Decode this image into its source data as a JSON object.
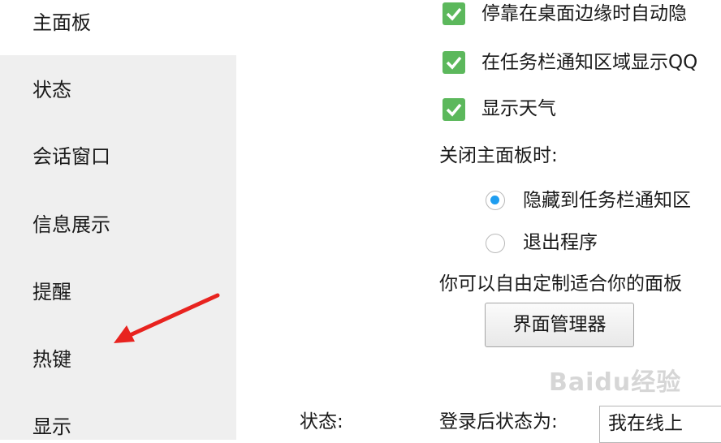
{
  "sidebar": {
    "items": [
      {
        "label": "主面板"
      },
      {
        "label": "状态"
      },
      {
        "label": "会话窗口"
      },
      {
        "label": "信息展示"
      },
      {
        "label": "提醒"
      },
      {
        "label": "热键"
      },
      {
        "label": "显示"
      }
    ]
  },
  "main": {
    "checkboxes": [
      {
        "label": "停靠在桌面边缘时自动隐",
        "checked": true
      },
      {
        "label": "在任务栏通知区域显示QQ",
        "checked": true
      },
      {
        "label": "显示天气",
        "checked": true
      }
    ],
    "close_label": "关闭主面板时:",
    "radios": [
      {
        "label": "隐藏到任务栏通知区",
        "checked": true
      },
      {
        "label": "退出程序",
        "checked": false
      }
    ],
    "customize_text": "你可以自由定制适合你的面板",
    "interface_manager_button": "界面管理器",
    "status_section_label": "状态:",
    "login_status_label": "登录后状态为:",
    "login_status_value": "我在线上"
  },
  "overlay": {
    "arrow_color": "#e8231f",
    "watermark": "Baidu经验",
    "check_color": "#5cb85c",
    "radio_color": "#1e9df0"
  }
}
